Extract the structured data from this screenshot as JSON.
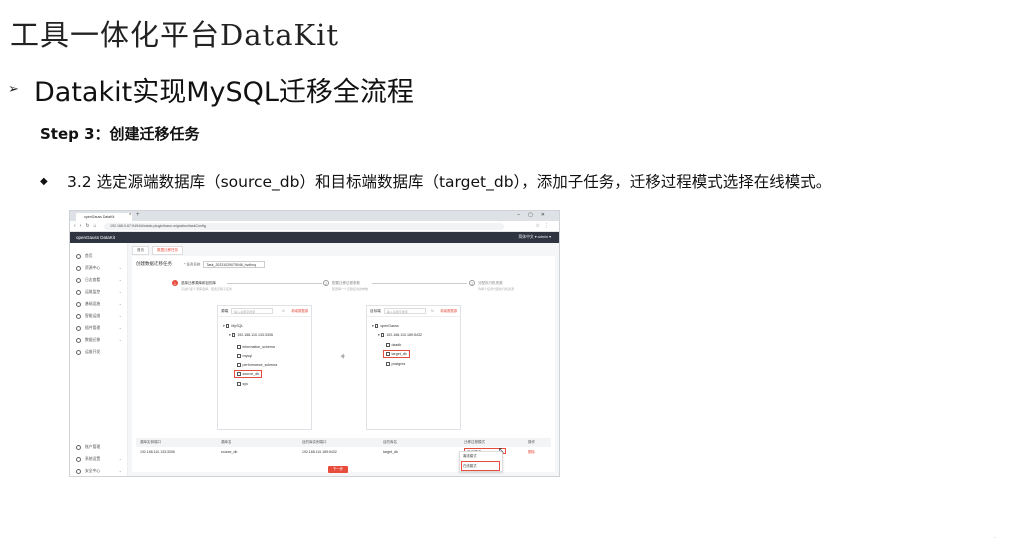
{
  "slide": {
    "title": "工具一体化平台DataKit",
    "section_arrow": "➢",
    "section_title": "Datakit实现MySQL迁移全流程",
    "step_title": "Step 3：创建迁移任务",
    "bullet_mark": "◆",
    "bullet_text": "3.2 选定源端数据库（source_db）和目标端数据库（target_db），添加子任务，迁移过程模式选择在线模式。"
  },
  "screenshot": {
    "browser_tab": "openGauss DataKit",
    "url": "192.168.0.67:9494/#/static-plugin/base-migration/taskConfig",
    "app_brand": "openGauss DataKit",
    "header_right": "简体中文  ▾   admin ▾",
    "sidebar": [
      {
        "label": "首页"
      },
      {
        "label": "资源中心"
      },
      {
        "label": "日志查看"
      },
      {
        "label": "运维监控"
      },
      {
        "label": "基础设施"
      },
      {
        "label": "智能运维"
      },
      {
        "label": "插件管理"
      },
      {
        "label": "数据迁移"
      },
      {
        "label": "运维开发"
      },
      {
        "label": "账户管理"
      },
      {
        "label": "系统设置"
      },
      {
        "label": "安全中心"
      }
    ],
    "breadcrumbs": [
      "首页",
      "数据迁移任务"
    ],
    "panel_title": "创建数据迁移任务",
    "task_name_label": "* 任务名称",
    "task_name_value": "Task_20231029075046_hvdhcq",
    "steps": [
      {
        "num": "1",
        "title": "选择迁移源库和目的库",
        "desc": "可进行多个源库选择，配置迁移子任务"
      },
      {
        "num": "2",
        "title": "配置迁移过程参数",
        "desc": "配置每一个迁移任务的参数"
      },
      {
        "num": "3",
        "title": "分配执行机资源",
        "desc": "为每个任务分配执行机资源"
      }
    ],
    "source_tree": {
      "label": "源端",
      "search_placeholder": "输入关键字搜索",
      "link": "新增数据源",
      "nodes": [
        "MySQL",
        "192.168.110.133:3306",
        "information_schema",
        "mysql",
        "performance_schema",
        "source_db",
        "sys"
      ]
    },
    "target_tree": {
      "label": "目标端",
      "search_placeholder": "输入关键字搜索",
      "link": "新增数据源",
      "nodes": [
        "openGauss",
        "192.168.110.189:5432",
        "dsadb",
        "target_db",
        "postgres"
      ]
    },
    "table_headers": [
      "源库实例端口",
      "源库名",
      "目的库实例端口",
      "目的库名",
      "迁移过程模式",
      "操作"
    ],
    "table_row": [
      "192.168.110.133:3306",
      "source_db",
      "192.168.110.189:5432",
      "target_db",
      "离线模式",
      "删除"
    ],
    "dropdown_options": [
      "离线模式",
      "在线模式"
    ],
    "next_button": "下一步"
  }
}
